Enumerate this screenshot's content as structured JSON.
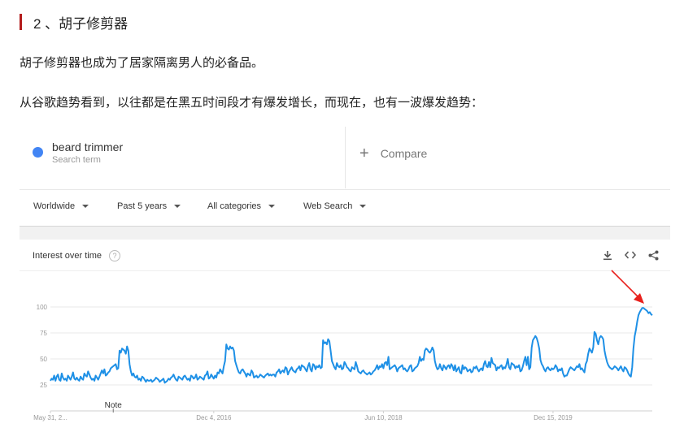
{
  "article": {
    "heading": "2 、胡子修剪器",
    "para1": "胡子修剪器也成为了居家隔离男人的必备品。",
    "para2": "从谷歌趋势看到，以往都是在黑五时间段才有爆发增长，而现在，也有一波爆发趋势："
  },
  "trends": {
    "term": "beard trimmer",
    "term_sub": "Search term",
    "compare_label": "Compare",
    "filters": [
      "Worldwide",
      "Past 5 years",
      "All categories",
      "Web Search"
    ],
    "card_title": "Interest over time",
    "help_glyph": "?",
    "tools": [
      "download-icon",
      "embed-icon",
      "share-icon"
    ],
    "note_label": "Note",
    "series_color": "#1e90e6",
    "arrow_color": "#e8201c"
  },
  "chart_data": {
    "type": "line",
    "title": "Interest over time",
    "series": [
      {
        "name": "beard trimmer",
        "values": [
          29,
          31,
          30,
          34,
          29,
          33,
          35,
          30,
          29,
          36,
          32,
          30,
          31,
          29,
          34,
          32,
          30,
          33,
          37,
          31,
          30,
          32,
          30,
          29,
          33,
          31,
          30,
          36,
          34,
          33,
          38,
          35,
          32,
          30,
          31,
          29,
          34,
          32,
          30,
          33,
          36,
          39,
          36,
          40,
          34,
          35,
          37,
          38,
          41,
          42,
          43,
          44,
          45,
          40,
          41,
          58,
          56,
          60,
          59,
          58,
          55,
          62,
          58,
          45,
          38,
          34,
          36,
          33,
          32,
          34,
          30,
          31,
          29,
          33,
          32,
          30,
          28,
          30,
          29,
          29,
          30,
          28,
          29,
          30,
          32,
          31,
          30,
          28,
          29,
          30,
          31,
          27,
          28,
          29,
          31,
          30,
          32,
          33,
          35,
          32,
          30,
          29,
          33,
          32,
          31,
          30,
          33,
          34,
          32,
          30,
          31,
          29,
          34,
          33,
          31,
          32,
          35,
          30,
          31,
          33,
          32,
          31,
          30,
          34,
          35,
          38,
          31,
          32,
          35,
          33,
          31,
          34,
          32,
          37,
          36,
          40,
          38,
          36,
          43,
          48,
          64,
          60,
          59,
          62,
          60,
          61,
          58,
          48,
          44,
          40,
          37,
          36,
          39,
          40,
          38,
          36,
          33,
          36,
          35,
          34,
          39,
          37,
          32,
          33,
          34,
          32,
          33,
          35,
          34,
          33,
          32,
          34,
          35,
          36,
          34,
          35,
          34,
          35,
          35,
          33,
          37,
          38,
          40,
          36,
          38,
          39,
          37,
          42,
          41,
          35,
          38,
          40,
          42,
          39,
          38,
          37,
          40,
          41,
          43,
          39,
          44,
          43,
          42,
          40,
          38,
          43,
          46,
          40,
          38,
          45,
          44,
          40,
          43,
          42,
          44,
          41,
          42,
          68,
          65,
          66,
          64,
          69,
          67,
          58,
          48,
          45,
          42,
          40,
          46,
          43,
          42,
          44,
          40,
          41,
          47,
          45,
          42,
          41,
          39,
          38,
          42,
          41,
          40,
          47,
          43,
          38,
          37,
          36,
          38,
          39,
          37,
          36,
          35,
          36,
          37,
          35,
          36,
          38,
          39,
          41,
          44,
          40,
          43,
          42,
          45,
          41,
          46,
          47,
          44,
          52,
          40,
          41,
          42,
          43,
          44,
          42,
          38,
          41,
          42,
          43,
          44,
          40,
          41,
          39,
          38,
          40,
          43,
          44,
          38,
          39,
          41,
          42,
          43,
          46,
          52,
          48,
          50,
          49,
          58,
          60,
          59,
          57,
          56,
          58,
          61,
          58,
          48,
          43,
          40,
          41,
          45,
          41,
          39,
          44,
          42,
          40,
          43,
          44,
          41,
          45,
          43,
          39,
          44,
          38,
          40,
          42,
          37,
          36,
          44,
          40,
          42,
          41,
          38,
          39,
          40,
          37,
          38,
          42,
          41,
          43,
          40,
          38,
          40,
          41,
          39,
          45,
          48,
          43,
          42,
          47,
          42,
          51,
          46,
          45,
          44,
          39,
          42,
          41,
          43,
          44,
          40,
          42,
          41,
          45,
          50,
          42,
          40,
          46,
          45,
          44,
          41,
          43,
          42,
          44,
          38,
          39,
          43,
          48,
          52,
          44,
          52,
          40,
          42,
          61,
          68,
          70,
          72,
          70,
          66,
          60,
          49,
          45,
          43,
          40,
          38,
          41,
          42,
          40,
          39,
          41,
          40,
          41,
          44,
          42,
          38,
          40,
          39,
          41,
          36,
          33,
          34,
          34,
          37,
          40,
          42,
          41,
          40,
          39,
          41,
          43,
          42,
          45,
          40,
          41,
          39,
          37,
          45,
          48,
          55,
          60,
          58,
          56,
          61,
          76,
          74,
          68,
          64,
          70,
          72,
          71,
          69,
          58,
          52,
          47,
          44,
          42,
          41,
          40,
          41,
          43,
          42,
          41,
          39,
          41,
          43,
          40,
          38,
          42,
          41,
          39,
          36,
          34,
          33,
          42,
          60,
          72,
          78,
          86,
          92,
          95,
          97,
          99,
          99,
          98,
          97,
          96,
          94,
          95,
          93,
          92
        ]
      }
    ],
    "x_labels": [
      "May 31, 2...",
      "Dec 4, 2016",
      "Jun 10, 2018",
      "Dec 15, 2019"
    ],
    "x_label_index": [
      0,
      130,
      265,
      400
    ],
    "y_ticks": [
      100,
      75,
      50,
      25
    ],
    "ylim": [
      0,
      100
    ],
    "note_index": 50,
    "grid": true
  }
}
